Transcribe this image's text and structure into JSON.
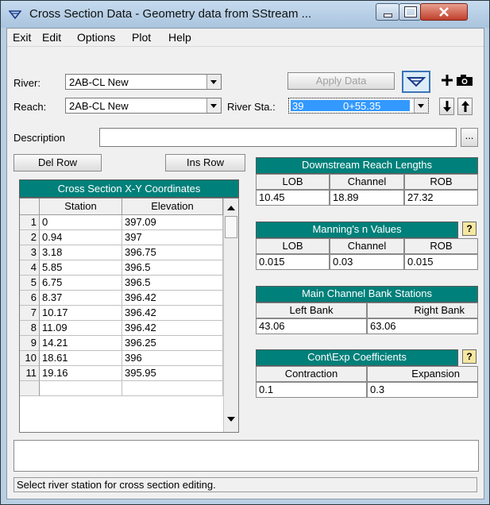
{
  "window": {
    "title": "Cross Section Data - Geometry data from SStream ..."
  },
  "menu": [
    {
      "label": "Exit"
    },
    {
      "label": "Edit"
    },
    {
      "label": "Options"
    },
    {
      "label": "Plot"
    },
    {
      "label": "Help"
    }
  ],
  "river": {
    "label": "River:",
    "value": "2AB-CL New"
  },
  "reach": {
    "label": "Reach:",
    "value": "2AB-CL New"
  },
  "river_sta": {
    "label": "River Sta.:",
    "value_a": "39",
    "value_b": "0+55.35"
  },
  "apply_data_label": "Apply Data",
  "description": {
    "label": "Description",
    "value": "",
    "browse_label": "..."
  },
  "del_row_label": "Del Row",
  "ins_row_label": "Ins Row",
  "xy_table": {
    "title": "Cross Section X-Y Coordinates",
    "columns": [
      "Station",
      "Elevation"
    ],
    "rows": [
      {
        "n": "1",
        "station": "0",
        "elevation": "397.09"
      },
      {
        "n": "2",
        "station": "0.94",
        "elevation": "397"
      },
      {
        "n": "3",
        "station": "3.18",
        "elevation": "396.75"
      },
      {
        "n": "4",
        "station": "5.85",
        "elevation": "396.5"
      },
      {
        "n": "5",
        "station": "6.75",
        "elevation": "396.5"
      },
      {
        "n": "6",
        "station": "8.37",
        "elevation": "396.42"
      },
      {
        "n": "7",
        "station": "10.17",
        "elevation": "396.42"
      },
      {
        "n": "8",
        "station": "11.09",
        "elevation": "396.42"
      },
      {
        "n": "9",
        "station": "14.21",
        "elevation": "396.25"
      },
      {
        "n": "10",
        "station": "18.61",
        "elevation": "396"
      },
      {
        "n": "11",
        "station": "19.16",
        "elevation": "395.95"
      }
    ]
  },
  "reach_lengths": {
    "title": "Downstream Reach Lengths",
    "lob_label": "LOB",
    "channel_label": "Channel",
    "rob_label": "ROB",
    "lob": "10.45",
    "channel": "18.89",
    "rob": "27.32"
  },
  "mannings": {
    "title": "Manning's n Values",
    "lob_label": "LOB",
    "channel_label": "Channel",
    "rob_label": "ROB",
    "lob": "0.015",
    "channel": "0.03",
    "rob": "0.015"
  },
  "bank_stations": {
    "title": "Main Channel Bank Stations",
    "left_label": "Left Bank",
    "right_label": "Right Bank",
    "left": "43.06",
    "right": "63.06"
  },
  "coefficients": {
    "title": "Cont\\Exp  Coefficients",
    "contraction_label": "Contraction",
    "expansion_label": "Expansion",
    "contraction": "0.1",
    "expansion": "0.3"
  },
  "help_glyph": "?",
  "status": "Select river station for cross section editing.",
  "colors": {
    "teal": "#00807a",
    "selection": "#3399ff"
  }
}
